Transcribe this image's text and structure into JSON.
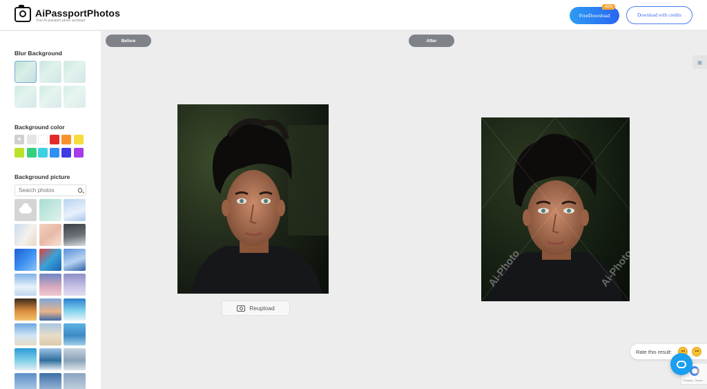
{
  "header": {
    "brand": "AiPassportPhotos",
    "tagline": "Your AI passport photo assistant",
    "free_download_label": "FreeDownload",
    "ads_badge": "ADS",
    "credits_label": "Download with credits"
  },
  "sidebar": {
    "blur_title": "Blur Background",
    "color_title": "Background color",
    "colors": [
      "#ffffff",
      "#e5e5e5",
      "#ffffff",
      "#e52a2a",
      "#f7922c",
      "#f6dc3c",
      "#b9e22a",
      "#35d07f",
      "#3ecfe0",
      "#2f8ff2",
      "#3f39e6",
      "#a63be8"
    ],
    "picture_title": "Background picture",
    "search_placeholder": "Search photos"
  },
  "main": {
    "before_label": "Before",
    "after_label": "After",
    "reupload_label": "Reupload",
    "watermark": "Ai-Photo"
  },
  "rating": {
    "prompt": "Rate this result:"
  },
  "recaptcha": {
    "text": "Privacy - Terms"
  }
}
